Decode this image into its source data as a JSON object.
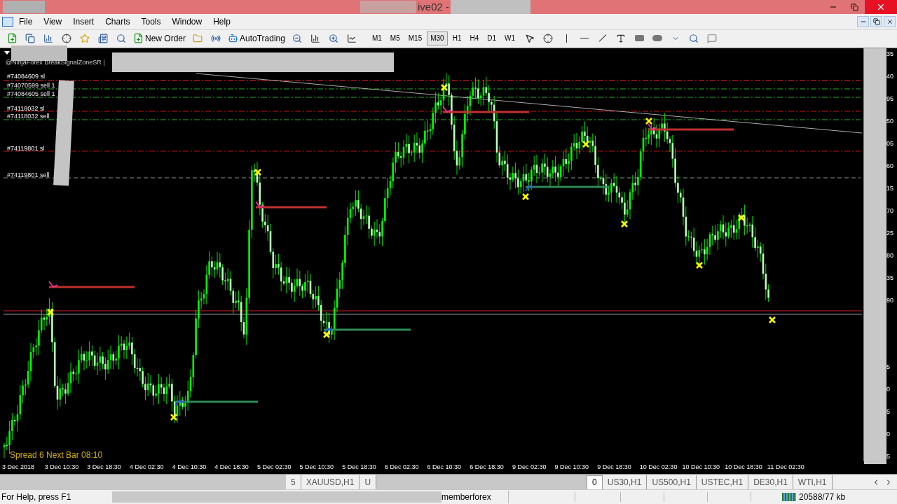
{
  "window": {
    "title": "ive02 -"
  },
  "menu": [
    "File",
    "View",
    "Insert",
    "Charts",
    "Tools",
    "Window",
    "Help"
  ],
  "toolbar": {
    "new_order": "New Order",
    "auto_trading": "AutoTrading",
    "timeframes": [
      {
        "label": "M1",
        "selected": false
      },
      {
        "label": "M5",
        "selected": false
      },
      {
        "label": "M15",
        "selected": false
      },
      {
        "label": "M30",
        "selected": true
      },
      {
        "label": "H1",
        "selected": false
      },
      {
        "label": "H4",
        "selected": false
      },
      {
        "label": "D1",
        "selected": false
      },
      {
        "label": "W1",
        "selected": false
      }
    ]
  },
  "chart": {
    "indicator_text": "@NinjaForex BreakSignalZoneSR |",
    "order_labels": [
      {
        "text": "#74084609 sl",
        "kind": "sl"
      },
      {
        "text": "#74070599 sell 1",
        "kind": "sell"
      },
      {
        "text": "#74084605 sell 1",
        "kind": "sell"
      },
      {
        "text": "#74118032 sl",
        "kind": "sl"
      },
      {
        "text": "#74118032 sell",
        "kind": "sell"
      },
      {
        "text": "#74119801 sl",
        "kind": "sl"
      },
      {
        "text": "#74119801 sell",
        "kind": "sell"
      }
    ],
    "spread_text": "Spread 6 Next Bar 08:10",
    "price_axis": [
      "35",
      "40",
      "95",
      "50",
      "05",
      "60",
      "15",
      "70",
      "25",
      "80",
      "35",
      "90",
      "5",
      "0",
      "5",
      "0",
      "5"
    ],
    "time_axis": [
      "3 Dec 2018",
      "3 Dec 10:30",
      "3 Dec 18:30",
      "4 Dec 02:30",
      "4 Dec 10:30",
      "4 Dec 18:30",
      "5 Dec 02:30",
      "5 Dec 10:30",
      "5 Dec 18:30",
      "6 Dec 02:30",
      "6 Dec 10:30",
      "6 Dec 18:30",
      "9 Dec 02:30",
      "9 Dec 10:30",
      "9 Dec 18:30",
      "10 Dec 02:30",
      "10 Dec 10:30",
      "10 Dec 18:30",
      "11 Dec 02:30"
    ]
  },
  "chart_tabs": [
    {
      "label": "5",
      "selected": false
    },
    {
      "label": "XAUUSD,H1",
      "selected": false
    },
    {
      "label": "U",
      "selected": false
    },
    {
      "label": "0",
      "selected": true
    },
    {
      "label": "US30,H1",
      "selected": false
    },
    {
      "label": "US500,H1",
      "selected": false
    },
    {
      "label": "USTEC,H1",
      "selected": false
    },
    {
      "label": "DE30,H1",
      "selected": false
    },
    {
      "label": "WTI,H1",
      "selected": false
    }
  ],
  "status_bar": {
    "help": "For Help, press F1",
    "profile": "memberforex",
    "traffic": "20588/77 kb"
  }
}
